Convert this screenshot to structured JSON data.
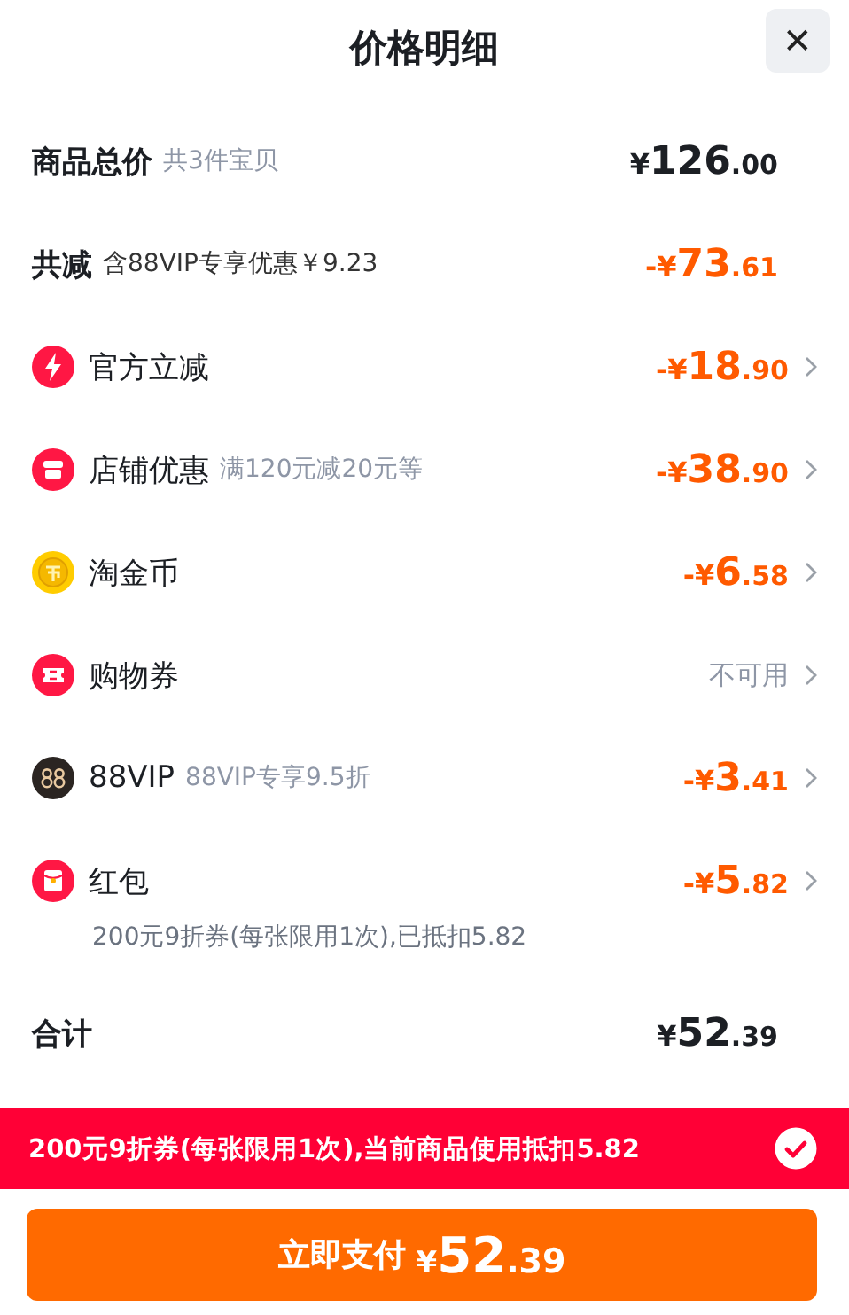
{
  "title": "价格明细",
  "close": {
    "label": "✕"
  },
  "rows": [
    {
      "kind": "header",
      "label": "商品总价",
      "note": "共3件宝贝",
      "amount": {
        "kind": "total",
        "sign": "¥",
        "int": "126",
        "dec": ".00"
      }
    },
    {
      "kind": "header",
      "label": "共减",
      "note": "含88VIP专享优惠￥9.23",
      "amount": {
        "kind": "discount",
        "sign": "-¥",
        "int": "73",
        "dec": ".61"
      }
    },
    {
      "kind": "item",
      "label": "官方立减",
      "amount": {
        "kind": "discount",
        "sign": "-¥",
        "int": "18",
        "dec": ".90"
      }
    },
    {
      "kind": "item",
      "label": "店铺优惠",
      "note": "满120元减20元等",
      "amount": {
        "kind": "discount",
        "sign": "-¥",
        "int": "38",
        "dec": ".90"
      }
    },
    {
      "kind": "item",
      "label": "淘金币",
      "amount": {
        "kind": "discount",
        "sign": "-¥",
        "int": "6",
        "dec": ".58"
      }
    },
    {
      "kind": "item",
      "label": "购物券",
      "status": "不可用"
    },
    {
      "kind": "item",
      "label": "88VIP",
      "note": "88VIP专享9.5折",
      "amount": {
        "kind": "discount",
        "sign": "-¥",
        "int": "3",
        "dec": ".41"
      }
    },
    {
      "kind": "item",
      "label": "红包",
      "detail": "200元9折券(每张限用1次),已抵扣5.82",
      "amount": {
        "kind": "discount",
        "sign": "-¥",
        "int": "5",
        "dec": ".82"
      }
    },
    {
      "kind": "header",
      "label": "合计",
      "amount": {
        "kind": "total",
        "sign": "¥",
        "int": "52",
        "dec": ".39"
      }
    }
  ],
  "banner": {
    "text": "200元9折券(每张限用1次),当前商品使用抵扣5.82",
    "checked": true
  },
  "pay_button": {
    "label": "立即支付",
    "amount": {
      "sign": "¥",
      "int": "52",
      "dec": ".39"
    }
  }
}
